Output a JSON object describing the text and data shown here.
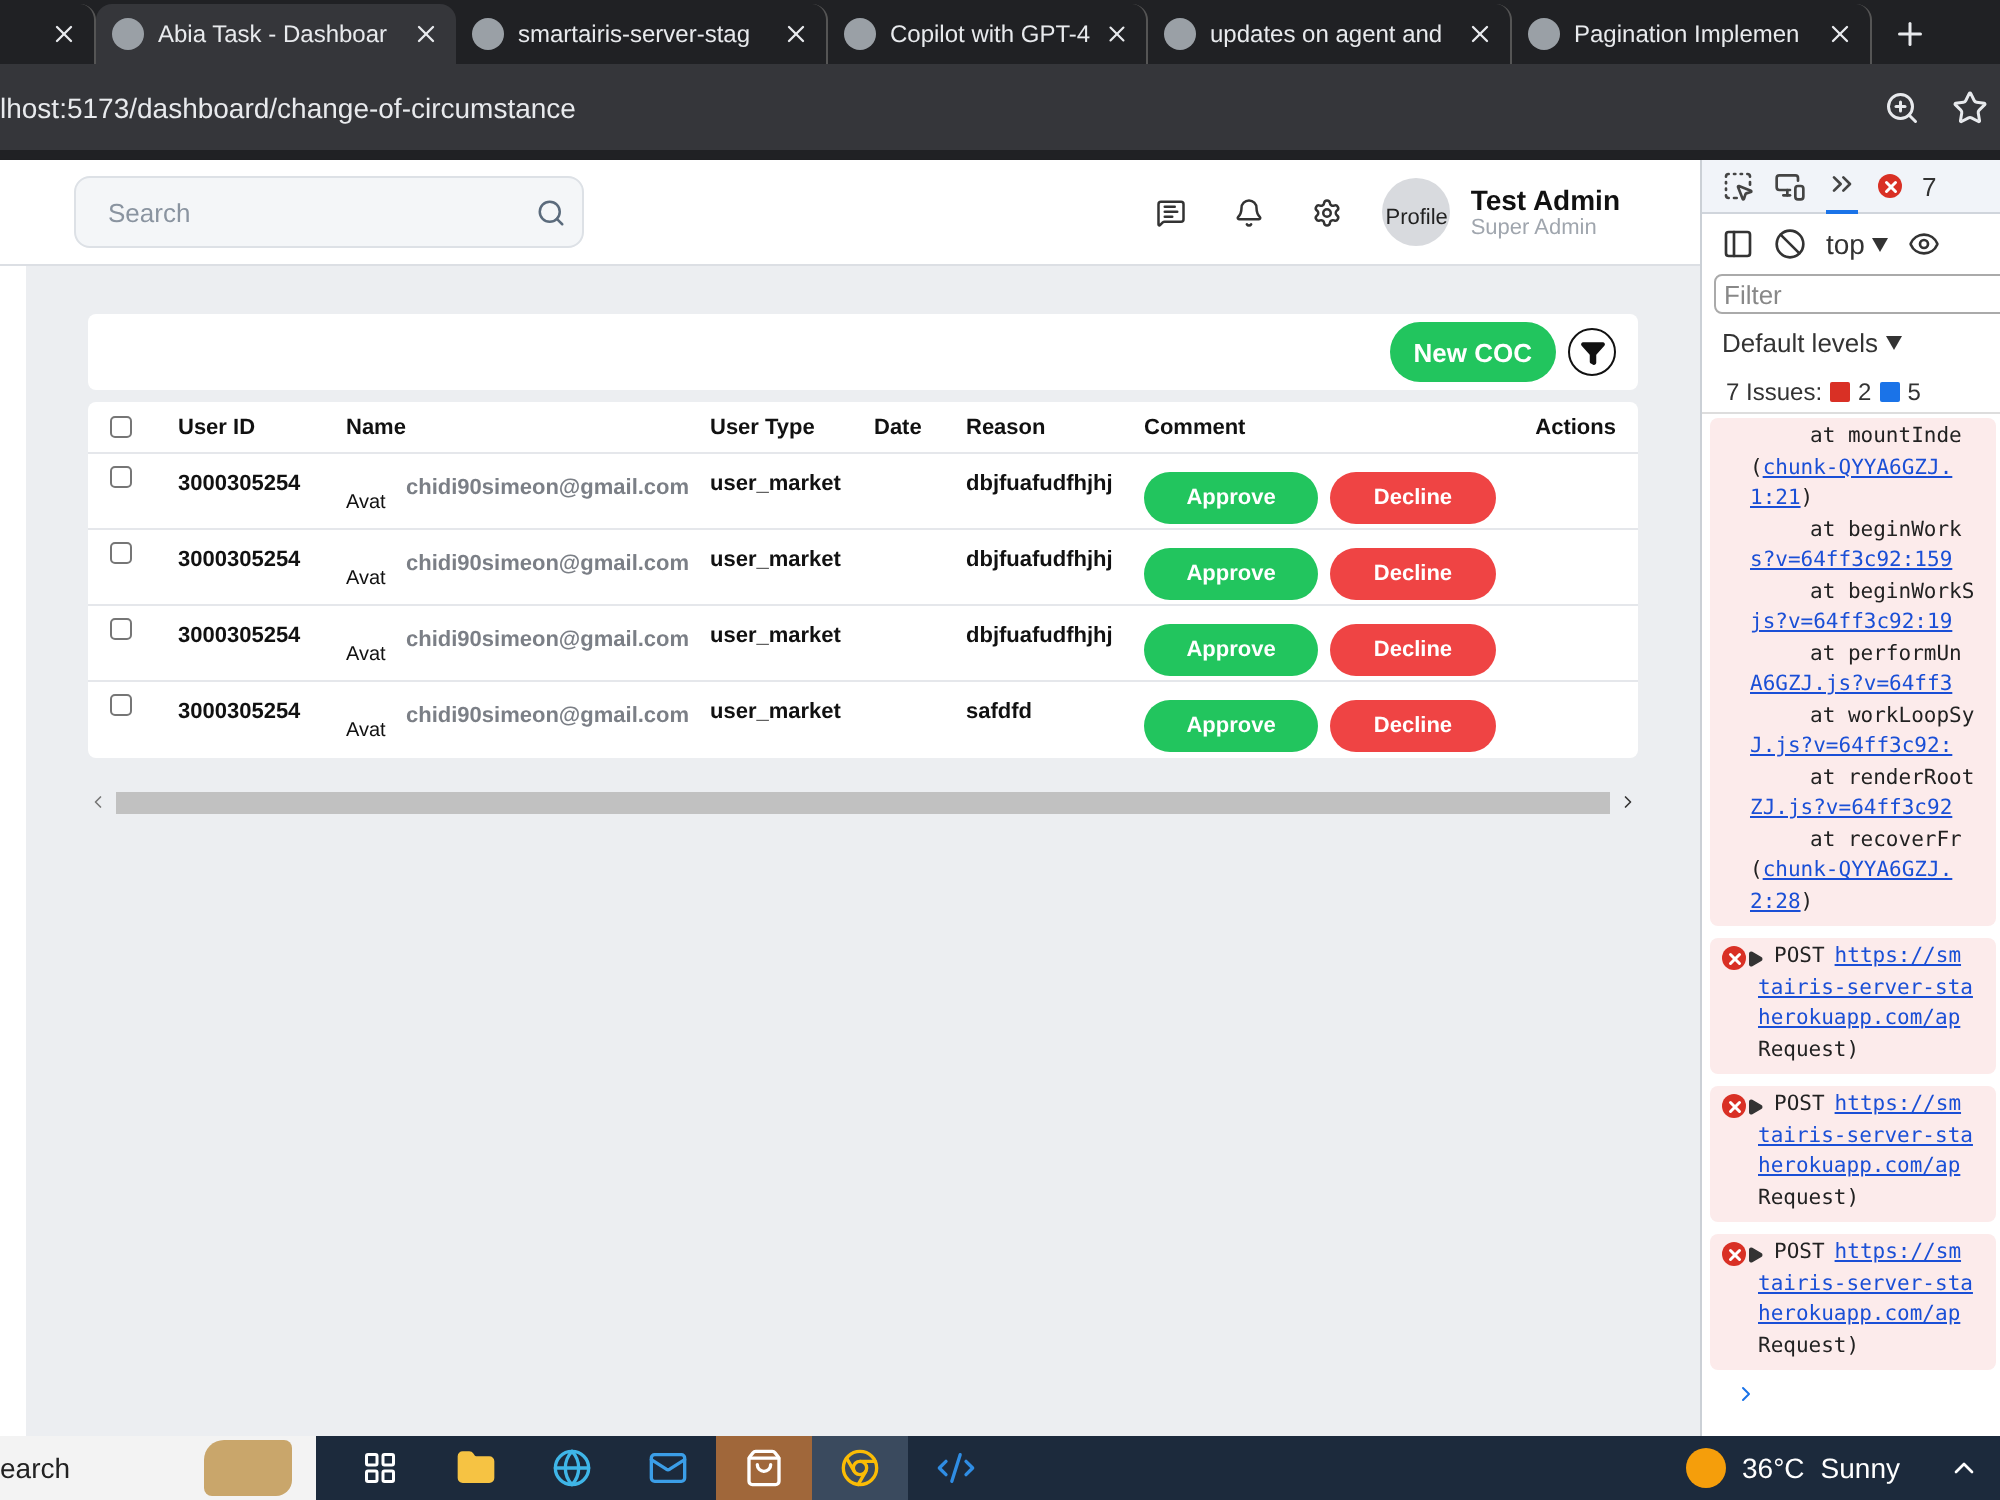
{
  "browser": {
    "tabs": [
      {
        "selected": false
      },
      {
        "title": "Abia Task - Dashboar",
        "selected": true
      },
      {
        "title": "smartairis-server-stag",
        "selected": false
      },
      {
        "title": "Copilot with GPT-4",
        "selected": false
      },
      {
        "title": "updates on agent and",
        "selected": false
      },
      {
        "title": "Pagination Implemen",
        "selected": false
      }
    ],
    "address": "lhost:5173/dashboard/change-of-circumstance"
  },
  "header": {
    "search": {
      "placeholder": "Search"
    },
    "profile": {
      "image_alt": "Profile",
      "name": "Test Admin",
      "role": "Super Admin"
    }
  },
  "toolbar": {
    "new_button": "New COC"
  },
  "table": {
    "columns": [
      "User ID",
      "Name",
      "User Type",
      "Date",
      "Reason",
      "Comment",
      "Actions"
    ],
    "rows": [
      {
        "checked": false,
        "user_id": "3000305254",
        "avatar_alt": "Avat",
        "email": "chidi90simeon@gmail.com",
        "user_type": "user_market",
        "reason": "dbjfuafudfhjhj",
        "approve": "Approve",
        "decline": "Decline"
      },
      {
        "checked": false,
        "user_id": "3000305254",
        "avatar_alt": "Avat",
        "email": "chidi90simeon@gmail.com",
        "user_type": "user_market",
        "reason": "dbjfuafudfhjhj",
        "approve": "Approve",
        "decline": "Decline"
      },
      {
        "checked": false,
        "user_id": "3000305254",
        "avatar_alt": "Avat",
        "email": "chidi90simeon@gmail.com",
        "user_type": "user_market",
        "reason": "dbjfuafudfhjhj",
        "approve": "Approve",
        "decline": "Decline"
      },
      {
        "checked": false,
        "user_id": "3000305254",
        "avatar_alt": "Avat",
        "email": "chidi90simeon@gmail.com",
        "user_type": "user_market",
        "reason": "safdfd",
        "approve": "Approve",
        "decline": "Decline"
      }
    ],
    "header_checked": false
  },
  "devtools": {
    "error_count": "7",
    "context": "top",
    "filter": {
      "placeholder": "Filter"
    },
    "levels": "Default levels",
    "issues": {
      "label": "7 Issues:",
      "errors": "2",
      "messages": "5"
    },
    "trace": [
      {
        "frame": "at mountInde"
      },
      {
        "before": "(",
        "link": "chunk-QYYA6GZJ."
      },
      {
        "link": "1:21",
        "after": ")"
      },
      {
        "frame": "at beginWork"
      },
      {
        "link": "s?v=64ff3c92:159"
      },
      {
        "frame": "at beginWorkS"
      },
      {
        "link": "js?v=64ff3c92:19"
      },
      {
        "frame": "at performUn"
      },
      {
        "link": "A6GZJ.js?v=64ff3"
      },
      {
        "frame": "at workLoopSy"
      },
      {
        "link": "J.js?v=64ff3c92:"
      },
      {
        "frame": "at renderRoot"
      },
      {
        "link": "ZJ.js?v=64ff3c92"
      },
      {
        "frame": "at recoverFr"
      },
      {
        "before": "(",
        "link": "chunk-QYYA6GZJ."
      },
      {
        "link": "2:28",
        "after": ")"
      }
    ],
    "errors": [
      {
        "method": "POST",
        "url_lines": [
          "https://sm",
          "tairis-server-sta",
          "herokuapp.com/ap"
        ],
        "tail": "Request)"
      },
      {
        "method": "POST",
        "url_lines": [
          "https://sm",
          "tairis-server-sta",
          "herokuapp.com/ap"
        ],
        "tail": "Request)"
      },
      {
        "method": "POST",
        "url_lines": [
          "https://sm",
          "tairis-server-sta",
          "herokuapp.com/ap"
        ],
        "tail": "Request)"
      }
    ]
  },
  "taskbar": {
    "search": "earch",
    "temperature": "36°C",
    "weather": "Sunny"
  }
}
